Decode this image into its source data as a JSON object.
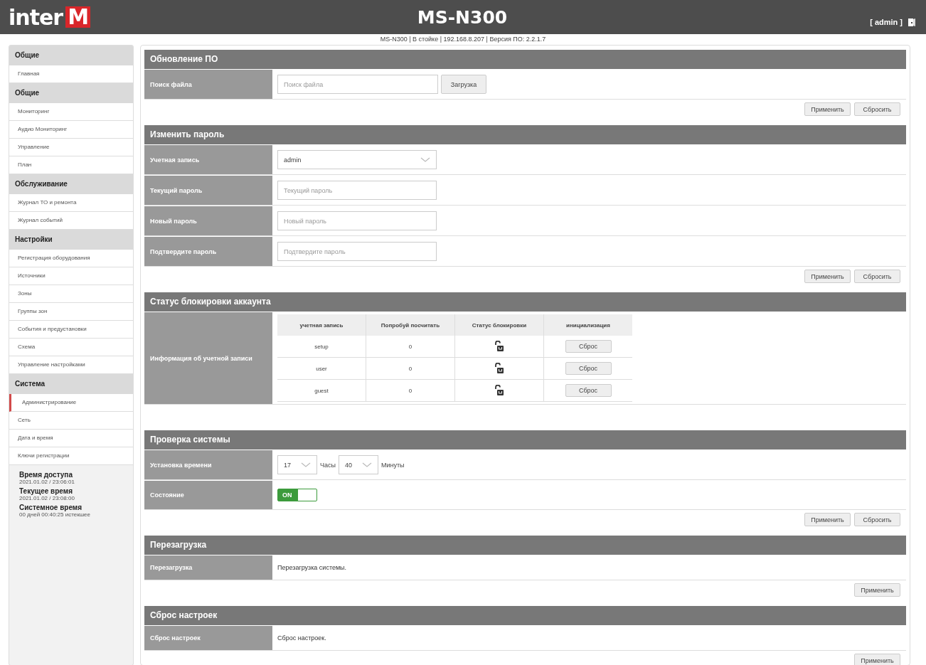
{
  "header": {
    "logo": {
      "text": "inter",
      "mark": "M"
    },
    "title": "MS-N300",
    "user": "[ admin ]"
  },
  "subtitle": "MS-N300  | В стойке  | 192.168.8.207  | Версия ПО:  2.2.1.7",
  "sidebar": {
    "groups": [
      {
        "title": "Общие",
        "items": [
          {
            "label": "Главная",
            "selected": false
          }
        ]
      },
      {
        "title": "Общие",
        "items": [
          {
            "label": "Мониторинг",
            "selected": false
          },
          {
            "label": "Аудио Мониторинг",
            "selected": false
          },
          {
            "label": "Управление",
            "selected": false
          },
          {
            "label": "План",
            "selected": false
          }
        ]
      },
      {
        "title": "Обслуживание",
        "items": [
          {
            "label": "Журнал ТО и ремонта",
            "selected": false
          },
          {
            "label": "Журнал событий",
            "selected": false
          }
        ]
      },
      {
        "title": "Настройки",
        "items": [
          {
            "label": "Регистрация оборудования",
            "selected": false
          },
          {
            "label": "Источники",
            "selected": false
          },
          {
            "label": "Зоны",
            "selected": false
          },
          {
            "label": "Группы зон",
            "selected": false
          },
          {
            "label": "События и предустановки",
            "selected": false
          },
          {
            "label": "Схема",
            "selected": false
          },
          {
            "label": "Управление настройками",
            "selected": false
          }
        ]
      },
      {
        "title": "Система",
        "items": [
          {
            "label": "Администрирование",
            "selected": true
          },
          {
            "label": "Сеть",
            "selected": false
          },
          {
            "label": "Дата и время",
            "selected": false
          },
          {
            "label": "Ключи регистрации",
            "selected": false
          }
        ]
      }
    ],
    "info": [
      {
        "label": "Время доступа",
        "value": "2021.01.02 / 23:06:01"
      },
      {
        "label": "Текущее время",
        "value": "2021.01.02 / 23:08:00"
      },
      {
        "label": "Системное время",
        "value": "00 дней 00:40:25 истекшее"
      }
    ]
  },
  "sections": [
    {
      "title": "Обновление ПО",
      "rows": [
        {
          "kind": "file",
          "label": "Поиск файла",
          "placeholder": "Поиск файла",
          "button": "Загрузка"
        }
      ],
      "buttons": [
        "Применить",
        "Сбросить"
      ]
    },
    {
      "title": "Изменить пароль",
      "rows": [
        {
          "kind": "select",
          "label": "Учетная запись",
          "value": "admin"
        },
        {
          "kind": "password",
          "label": "Текущий пароль",
          "placeholder": "Текущий пароль"
        },
        {
          "kind": "password",
          "label": "Новый пароль",
          "placeholder": "Новый пароль"
        },
        {
          "kind": "password",
          "label": "Подтвердите пароль",
          "placeholder": "Подтвердите пароль"
        }
      ],
      "buttons": [
        "Применить",
        "Сбросить"
      ]
    },
    {
      "title": "Статус блокировки аккаунта",
      "rows": [
        {
          "kind": "table",
          "label": "Информация об учетной записи",
          "columns": [
            "учетная запись",
            "Попробуй посчитать",
            "Статус блокировки",
            "инициализация"
          ],
          "rows": [
            {
              "account": "setup",
              "count": "0",
              "locked": false,
              "button": "Сброс"
            },
            {
              "account": "user",
              "count": "0",
              "locked": false,
              "button": "Сброс"
            },
            {
              "account": "guest",
              "count": "0",
              "locked": false,
              "button": "Сброс"
            }
          ]
        }
      ]
    },
    {
      "title": "Проверка системы",
      "rows": [
        {
          "kind": "time",
          "label": "Установка времени",
          "hour": "17",
          "hour_unit": "Часы",
          "minute": "40",
          "minute_unit": "Минуты"
        },
        {
          "kind": "toggle",
          "label": "Состояние",
          "text": "ON",
          "on": true
        }
      ],
      "buttons": [
        "Применить",
        "Сбросить"
      ]
    },
    {
      "title": "Перезагрузка",
      "rows": [
        {
          "kind": "text",
          "label": "Перезагрузка",
          "text": "Перезагрузка системы."
        }
      ],
      "buttons": [
        "Применить"
      ]
    },
    {
      "title": "Сброс настроек",
      "rows": [
        {
          "kind": "text",
          "label": "Сброс настроек",
          "text": "Сброс настроек."
        }
      ],
      "buttons": [
        "Применить"
      ]
    }
  ]
}
